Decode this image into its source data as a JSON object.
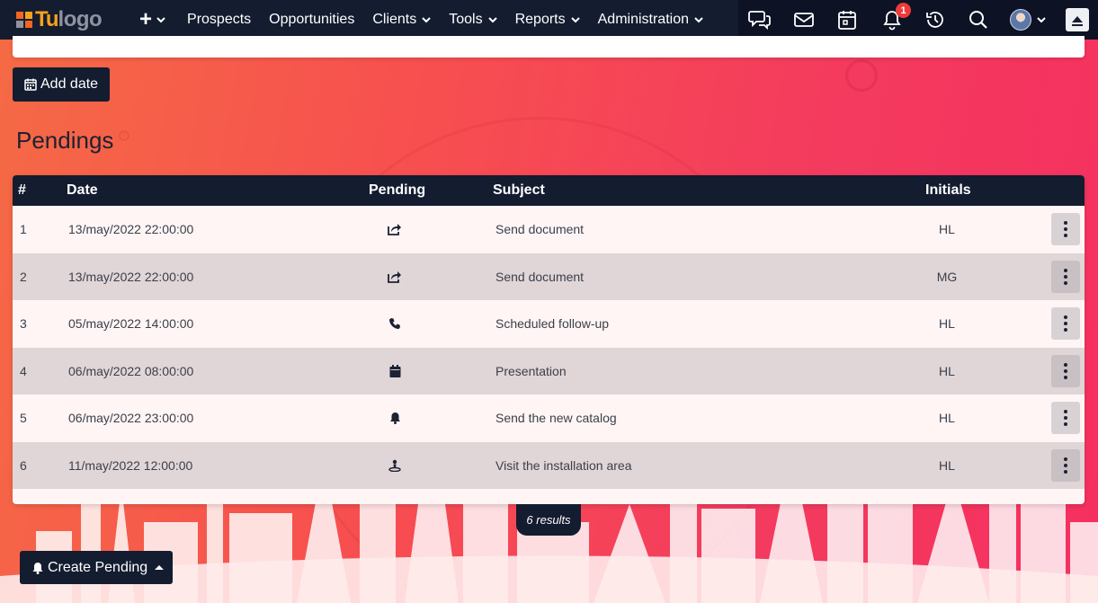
{
  "brand": {
    "logo_tu": "Tu",
    "logo_text": "logo",
    "accent": "#f7a11a",
    "grid_colors": [
      "#f26522",
      "#f7a11a",
      "#8f93a0",
      "#f26522"
    ]
  },
  "navbar": {
    "plus": "+",
    "items": [
      {
        "label": "Prospects",
        "has_dropdown": false
      },
      {
        "label": "Opportunities",
        "has_dropdown": false
      },
      {
        "label": "Clients",
        "has_dropdown": true
      },
      {
        "label": "Tools",
        "has_dropdown": true
      },
      {
        "label": "Reports",
        "has_dropdown": true
      },
      {
        "label": "Administration",
        "has_dropdown": true
      }
    ],
    "icons": [
      "chat-icon",
      "mail-icon",
      "calendar-icon",
      "bell-icon",
      "history-icon",
      "search-icon",
      "avatar",
      "scroll-top-icon"
    ],
    "notification_count": "1",
    "bg": "#141c30"
  },
  "add_date_label": "Add date",
  "page_title": "Pendings",
  "table": {
    "headers": {
      "num": "#",
      "date": "Date",
      "pending": "Pending",
      "subject": "Subject",
      "initials": "Initials"
    },
    "rows": [
      {
        "num": "1",
        "date": "13/may/2022 22:00:00",
        "icon": "share-icon",
        "subject": "Send document",
        "initials": "HL"
      },
      {
        "num": "2",
        "date": "13/may/2022 22:00:00",
        "icon": "share-icon",
        "subject": "Send document",
        "initials": "MG"
      },
      {
        "num": "3",
        "date": "05/may/2022 14:00:00",
        "icon": "phone-icon",
        "subject": "Scheduled follow-up",
        "initials": "HL"
      },
      {
        "num": "4",
        "date": "06/may/2022 08:00:00",
        "icon": "calendar-icon",
        "subject": "Presentation",
        "initials": "HL"
      },
      {
        "num": "5",
        "date": "06/may/2022 23:00:00",
        "icon": "bell-icon",
        "subject": "Send the new catalog",
        "initials": "HL"
      },
      {
        "num": "6",
        "date": "11/may/2022 12:00:00",
        "icon": "visit-icon",
        "subject": "Visit the installation area",
        "initials": "HL"
      }
    ]
  },
  "results_label": "6 results",
  "create_pending_label": "Create Pending"
}
